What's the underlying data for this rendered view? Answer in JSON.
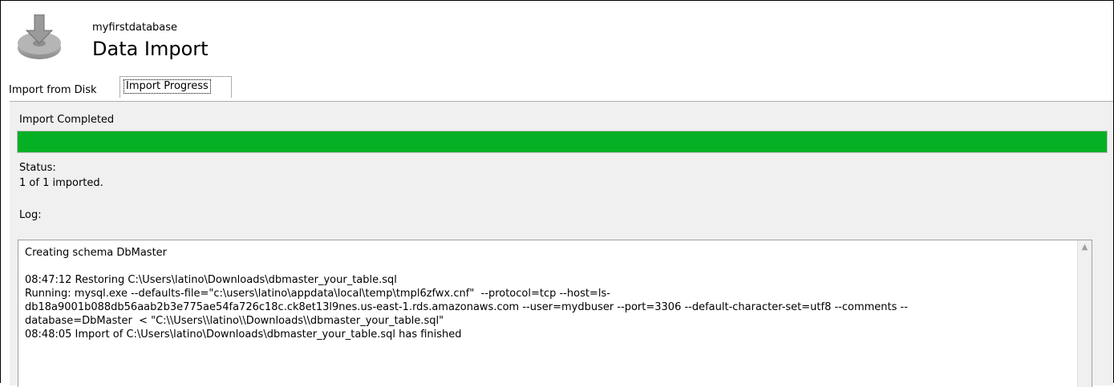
{
  "header": {
    "subtitle": "myfirstdatabase",
    "title": "Data Import",
    "icon": "database-import-icon"
  },
  "tabs": [
    {
      "label": "Import from Disk",
      "active": false
    },
    {
      "label": "Import Progress",
      "active": true
    }
  ],
  "progress": {
    "heading": "Import Completed",
    "fraction": 1.0,
    "color": "#06b025",
    "status_label": "Status:",
    "status_value": "1 of 1 imported."
  },
  "log": {
    "label": "Log:",
    "lines": [
      "Creating schema DbMaster",
      "",
      "08:47:12 Restoring C:\\Users\\latino\\Downloads\\dbmaster_your_table.sql",
      "Running: mysql.exe --defaults-file=\"c:\\users\\latino\\appdata\\local\\temp\\tmpl6zfwx.cnf\"  --protocol=tcp --host=ls-",
      "db18a9001b088db56aab2b3e775ae54fa726c18c.ck8et13l9nes.us-east-1.rds.amazonaws.com --user=mydbuser --port=3306 --default-character-set=utf8 --comments --",
      "database=DbMaster  < \"C:\\\\Users\\\\latino\\\\Downloads\\\\dbmaster_your_table.sql\"",
      "08:48:05 Import of C:\\Users\\latino\\Downloads\\dbmaster_your_table.sql has finished"
    ]
  }
}
